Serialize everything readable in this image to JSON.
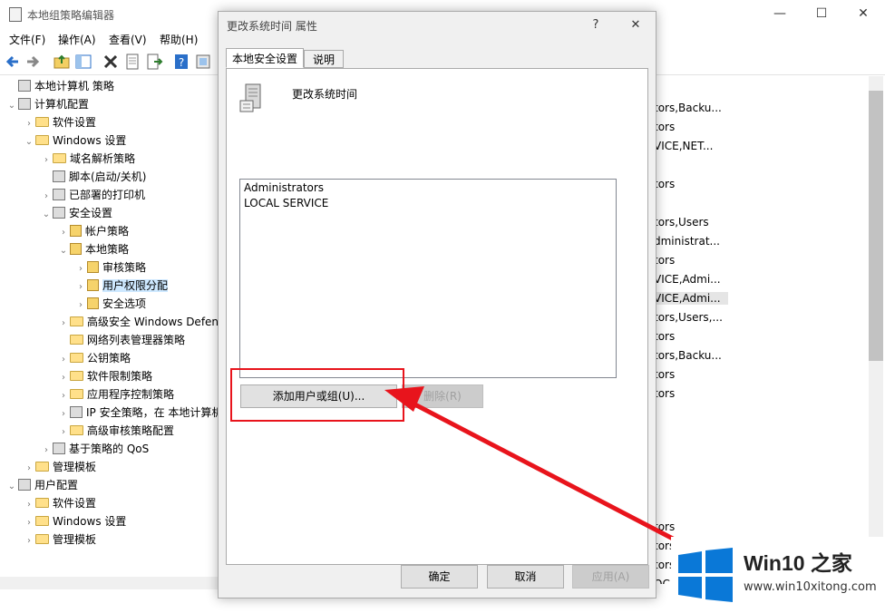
{
  "app": {
    "title": "本地组策略编辑器"
  },
  "window_controls": {
    "minimize": "—",
    "maximize": "☐",
    "close": "✕"
  },
  "menu": [
    "文件(F)",
    "操作(A)",
    "查看(V)",
    "帮助(H)"
  ],
  "tree": {
    "items": [
      {
        "label": "本地计算机 策略",
        "level": 0,
        "chev": "",
        "icon": "policy-icon"
      },
      {
        "label": "计算机配置",
        "level": 0,
        "chev": "⌄",
        "icon": "computer-icon"
      },
      {
        "label": "软件设置",
        "level": 1,
        "chev": "›",
        "icon": "folder-icon"
      },
      {
        "label": "Windows 设置",
        "level": 1,
        "chev": "⌄",
        "icon": "folder-icon"
      },
      {
        "label": "域名解析策略",
        "level": 2,
        "chev": "›",
        "icon": "folder-icon"
      },
      {
        "label": "脚本(启动/关机)",
        "level": 2,
        "chev": "",
        "icon": "script-icon"
      },
      {
        "label": "已部署的打印机",
        "level": 2,
        "chev": "›",
        "icon": "printer-icon"
      },
      {
        "label": "安全设置",
        "level": 2,
        "chev": "⌄",
        "icon": "security-icon"
      },
      {
        "label": "帐户策略",
        "level": 3,
        "chev": "›",
        "icon": "lock-folder-icon"
      },
      {
        "label": "本地策略",
        "level": 3,
        "chev": "⌄",
        "icon": "lock-folder-icon"
      },
      {
        "label": "审核策略",
        "level": 4,
        "chev": "›",
        "icon": "lock-folder-icon"
      },
      {
        "label": "用户权限分配",
        "level": 4,
        "chev": "›",
        "icon": "lock-folder-icon",
        "selected": true
      },
      {
        "label": "安全选项",
        "level": 4,
        "chev": "›",
        "icon": "lock-folder-icon"
      },
      {
        "label": "高级安全 Windows Defender 防火墙",
        "level": 3,
        "chev": "›",
        "icon": "folder-icon"
      },
      {
        "label": "网络列表管理器策略",
        "level": 3,
        "chev": "",
        "icon": "folder-icon"
      },
      {
        "label": "公钥策略",
        "level": 3,
        "chev": "›",
        "icon": "folder-icon"
      },
      {
        "label": "软件限制策略",
        "level": 3,
        "chev": "›",
        "icon": "folder-icon"
      },
      {
        "label": "应用程序控制策略",
        "level": 3,
        "chev": "›",
        "icon": "folder-icon"
      },
      {
        "label": "IP 安全策略，在 本地计算机",
        "level": 3,
        "chev": "›",
        "icon": "ipsec-icon"
      },
      {
        "label": "高级审核策略配置",
        "level": 3,
        "chev": "›",
        "icon": "folder-icon"
      },
      {
        "label": "基于策略的 QoS",
        "level": 2,
        "chev": "›",
        "icon": "chart-icon"
      },
      {
        "label": "管理模板",
        "level": 1,
        "chev": "›",
        "icon": "folder-icon"
      },
      {
        "label": "用户配置",
        "level": 0,
        "chev": "⌄",
        "icon": "user-icon"
      },
      {
        "label": "软件设置",
        "level": 1,
        "chev": "›",
        "icon": "folder-icon"
      },
      {
        "label": "Windows 设置",
        "level": 1,
        "chev": "›",
        "icon": "folder-icon"
      },
      {
        "label": "管理模板",
        "level": 1,
        "chev": "›",
        "icon": "folder-icon"
      }
    ]
  },
  "right_list": [
    {
      "text": "tors,Backu...",
      "row": 1
    },
    {
      "text": "tors",
      "row": 2
    },
    {
      "text": "VICE,NET...",
      "row": 3
    },
    {
      "text": "tors",
      "row": 5
    },
    {
      "text": "tors,Users",
      "row": 7
    },
    {
      "text": "dministrat...",
      "row": 8
    },
    {
      "text": "tors",
      "row": 9
    },
    {
      "text": "VICE,Admi...",
      "row": 10
    },
    {
      "text": "VICE,Admi...",
      "row": 11,
      "highlight": true
    },
    {
      "text": "tors,Users,...",
      "row": 12
    },
    {
      "text": "tors",
      "row": 13
    },
    {
      "text": "tors,Backu...",
      "row": 14
    },
    {
      "text": "tors",
      "row": 15
    },
    {
      "text": "tors",
      "row": 16
    },
    {
      "text": "tors",
      "row": 23
    },
    {
      "text": "tors",
      "row": 24
    },
    {
      "text": "tors",
      "row": 25
    },
    {
      "text": "OCA",
      "row": 26
    }
  ],
  "dialog": {
    "title": "更改系统时间 属性",
    "help": "?",
    "close": "✕",
    "tabs": [
      "本地安全设置",
      "说明"
    ],
    "policy_title": "更改系统时间",
    "members": [
      "Administrators",
      "LOCAL SERVICE"
    ],
    "add_button": "添加用户或组(U)...",
    "remove_button": "删除(R)",
    "ok_button": "确定",
    "cancel_button": "取消",
    "apply_button": "应用(A)"
  },
  "annotation": {
    "color": "#e8141c"
  },
  "watermark": {
    "brand": "Win10 之家",
    "url": "www.win10xitong.com",
    "colors": [
      "#0a78d7",
      "#0a78d7"
    ]
  }
}
